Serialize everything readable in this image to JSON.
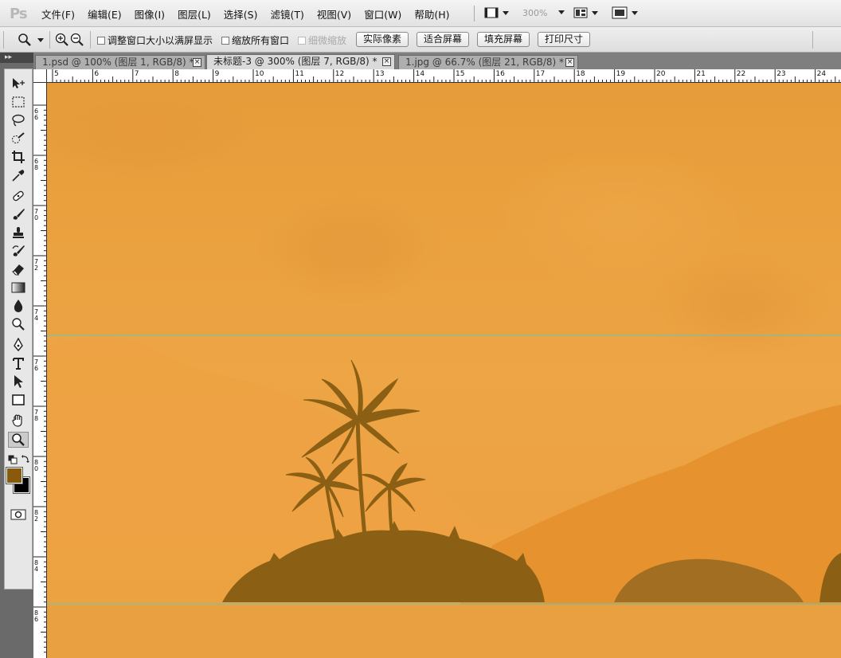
{
  "app": {
    "logo": "Ps"
  },
  "menu": [
    "文件(F)",
    "编辑(E)",
    "图像(I)",
    "图层(L)",
    "选择(S)",
    "滤镜(T)",
    "视图(V)",
    "窗口(W)",
    "帮助(H)"
  ],
  "menubar_controls": {
    "zoom_level": "300%"
  },
  "options": {
    "checkbox_resize": "调整窗口大小以满屏显示",
    "checkbox_zoom_all": "缩放所有窗口",
    "checkbox_scrubby": "细微缩放",
    "btn_actual_pixels": "实际像素",
    "btn_fit_screen": "适合屏幕",
    "btn_fill_screen": "填充屏幕",
    "btn_print_size": "打印尺寸"
  },
  "tabs": [
    {
      "label": "1.psd @ 100% (图层 1, RGB/8) *",
      "active": false
    },
    {
      "label": "未标题-3 @ 300% (图层 7, RGB/8) *",
      "active": true
    },
    {
      "label": "1.jpg @ 66.7% (图层 21, RGB/8) *",
      "active": false
    }
  ],
  "ruler": {
    "h_labels": [
      "5",
      "6",
      "7",
      "8",
      "9",
      "10",
      "11",
      "12",
      "13",
      "14",
      "15",
      "16",
      "17",
      "18",
      "19",
      "20",
      "21",
      "22",
      "23",
      "24"
    ],
    "v_labels": [
      "66",
      "68",
      "70",
      "72",
      "74",
      "76",
      "78",
      "80",
      "82",
      "84",
      "86"
    ]
  },
  "tools": [
    "move-icon",
    "marquee-icon",
    "lasso-icon",
    "quick-select-icon",
    "crop-icon",
    "eyedropper-icon",
    "healing-brush-icon",
    "brush-icon",
    "clone-stamp-icon",
    "history-brush-icon",
    "eraser-icon",
    "gradient-icon",
    "blur-icon",
    "dodge-icon",
    "pen-icon",
    "type-icon",
    "path-select-icon",
    "shape-icon",
    "hand-icon",
    "zoom-icon"
  ],
  "colors": {
    "foreground": "#8a5a0c",
    "background": "#000000",
    "sky_top": "#e8a038",
    "sky_mid": "#eda443",
    "hill_light": "#f0a74a",
    "hill_dark": "#e49232",
    "silhouette": "#8b5f14",
    "guide": "#5fc9c2"
  }
}
